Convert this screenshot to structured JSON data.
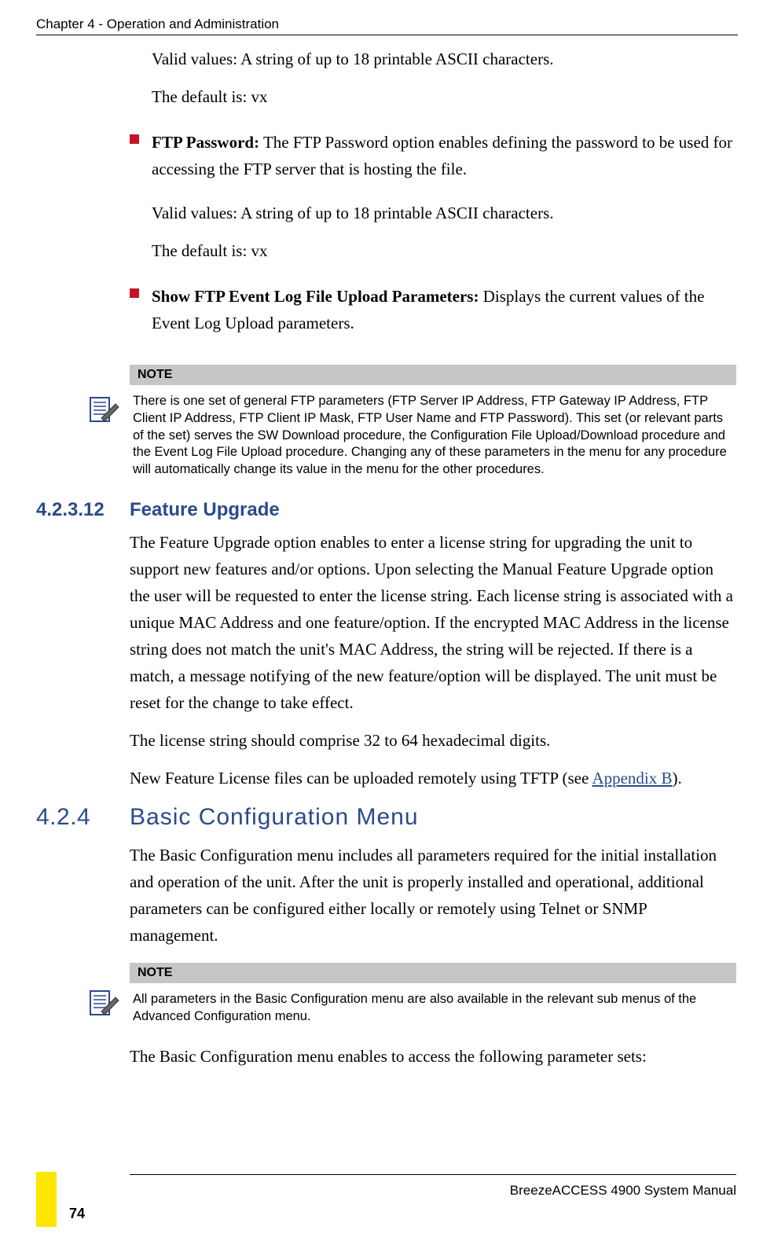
{
  "header": "Chapter 4 - Operation and Administration",
  "p1": "Valid values: A string of up to 18 printable ASCII characters.",
  "p2": "The default is: vx",
  "bullet1": {
    "label": "FTP Password:",
    "text": " The FTP Password option enables defining the password to be used for accessing the FTP server that is hosting the file."
  },
  "p3": "Valid values: A string of up to 18 printable ASCII characters.",
  "p4": "The default is: vx",
  "bullet2": {
    "label": "Show FTP Event Log File Upload Parameters:",
    "text": " Displays the current values of the Event Log Upload parameters."
  },
  "note1": {
    "head": "NOTE",
    "body": "There is one set of general FTP parameters (FTP Server IP Address, FTP Gateway IP Address, FTP Client IP Address, FTP Client IP Mask, FTP User Name and FTP Password). This set (or relevant parts of the set) serves the SW Download procedure, the Configuration File Upload/Download procedure and the Event Log File Upload procedure. Changing any of these parameters in the menu for any procedure will automatically change its value in the menu for the other procedures."
  },
  "sec1": {
    "num": "4.2.3.12",
    "title": "Feature Upgrade"
  },
  "p5": "The Feature Upgrade option enables to enter a license string for upgrading the unit to support new features and/or options. Upon selecting the Manual Feature Upgrade option the user will be requested to enter the license string. Each license string is associated with a unique MAC Address and one feature/option. If the encrypted MAC Address in the license string does not match the unit's MAC Address, the string will be rejected. If there is a match, a message notifying of the new feature/option will be displayed. The unit must be reset for the change to take effect.",
  "p6": "The license string should comprise 32 to 64 hexadecimal digits.",
  "p7a": "New Feature License files can be uploaded remotely using TFTP (see ",
  "p7link": "Appendix B",
  "p7b": ").",
  "sec2": {
    "num": "4.2.4",
    "title": "Basic Configuration Menu"
  },
  "p8": "The Basic Configuration menu includes all parameters required for the initial installation and operation of the unit. After the unit is properly installed and operational, additional parameters can be configured either locally or remotely using Telnet or SNMP management.",
  "note2": {
    "head": "NOTE",
    "body": "All parameters in the Basic Configuration menu are also available in the relevant sub menus of the Advanced Configuration menu."
  },
  "p9": "The Basic Configuration menu enables to access the following parameter sets:",
  "footer": "BreezeACCESS 4900 System Manual",
  "pageNumber": "74"
}
